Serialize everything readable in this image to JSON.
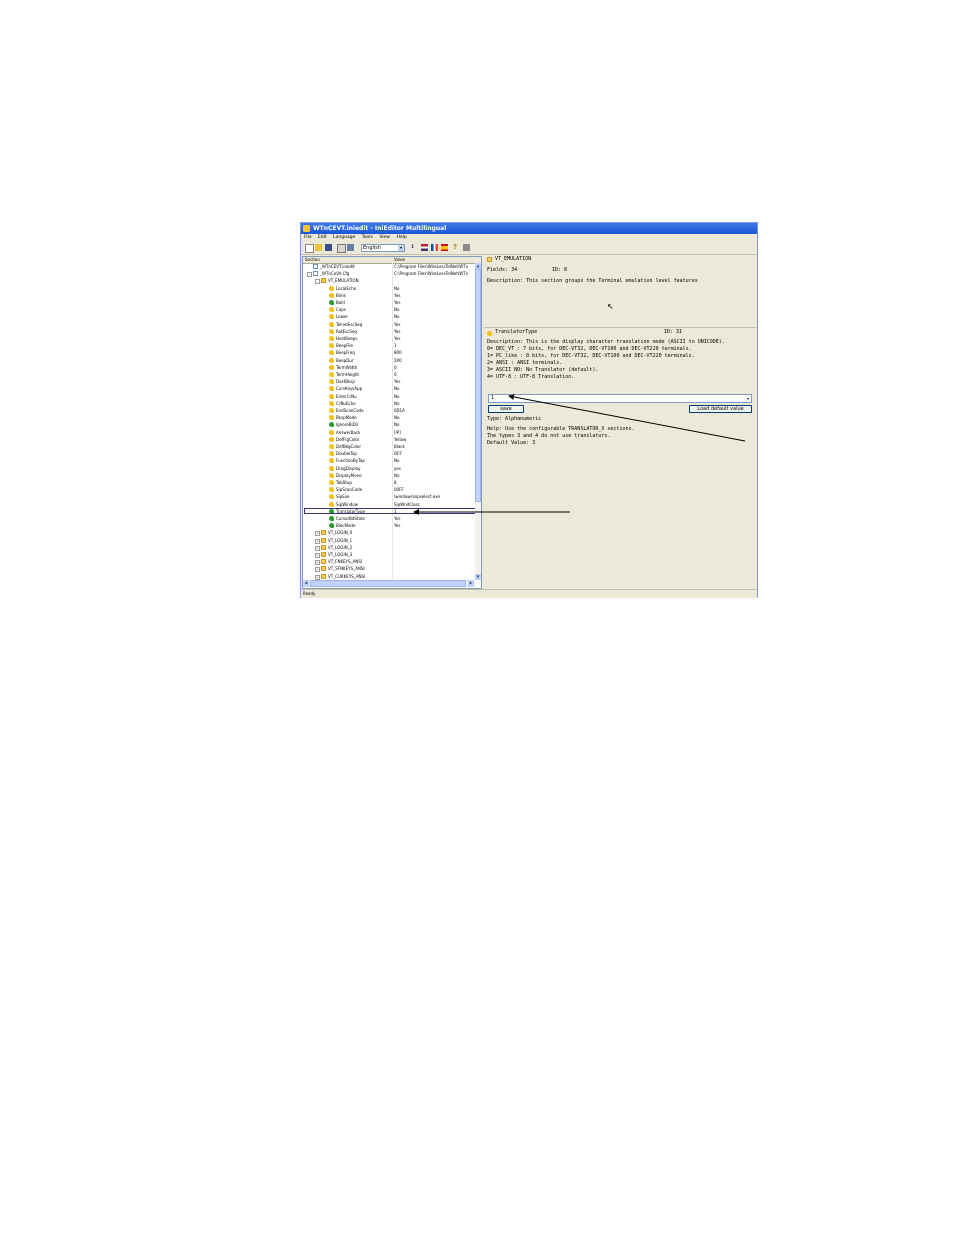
{
  "window": {
    "title": "WTnCEVT.iniedit - IniEditor Multilingual"
  },
  "menu": [
    "File",
    "Edit",
    "Language",
    "Tools",
    "View",
    "Help"
  ],
  "toolbar": {
    "language": "English"
  },
  "tree": {
    "headers": {
      "section": "Section",
      "value": "Value"
    },
    "rows": [
      {
        "name": "_WTnCEVT.iniedit",
        "value": "C:\\Program Files\\WireLessTelNet\\WTn",
        "icon": "file",
        "indent": 0,
        "pm": ""
      },
      {
        "name": "_WTnCeVA.Cfg",
        "value": "C:\\Program Files\\WireLessTelNet\\WTn",
        "icon": "file",
        "indent": 0,
        "pm": "-"
      },
      {
        "name": "VT_EMULATION",
        "value": "",
        "icon": "folder",
        "indent": 1,
        "pm": "-"
      },
      {
        "name": "LocalEcho",
        "value": "No",
        "icon": "key",
        "indent": 2
      },
      {
        "name": "Blink",
        "value": "Yes",
        "icon": "key",
        "indent": 2
      },
      {
        "name": "Bold",
        "value": "Yes",
        "icon": "keyg",
        "indent": 2
      },
      {
        "name": "Caps",
        "value": "No",
        "icon": "key",
        "indent": 2
      },
      {
        "name": "Lower",
        "value": "No",
        "icon": "key",
        "indent": 2
      },
      {
        "name": "TelnetEscSeq",
        "value": "Yes",
        "icon": "key",
        "indent": 2
      },
      {
        "name": "RotEscSeq",
        "value": "Yes",
        "icon": "key",
        "indent": 2
      },
      {
        "name": "HostBeeps",
        "value": "Yes",
        "icon": "key",
        "indent": 2
      },
      {
        "name": "BeepFile",
        "value": "1",
        "icon": "key",
        "indent": 2
      },
      {
        "name": "BeepFreq",
        "value": "800",
        "icon": "key",
        "indent": 2
      },
      {
        "name": "BeepDur",
        "value": "200",
        "icon": "key",
        "indent": 2
      },
      {
        "name": "TermWidth",
        "value": "0",
        "icon": "key",
        "indent": 2
      },
      {
        "name": "TermHeight",
        "value": "0",
        "icon": "key",
        "indent": 2
      },
      {
        "name": "DestBksp",
        "value": "Yes",
        "icon": "key",
        "indent": 2
      },
      {
        "name": "CursKeysApp",
        "value": "No",
        "icon": "key",
        "indent": 2
      },
      {
        "name": "EnterCrNu",
        "value": "No",
        "icon": "key",
        "indent": 2
      },
      {
        "name": "CrNuEcho",
        "value": "No",
        "icon": "key",
        "indent": 2
      },
      {
        "name": "EndScanCode",
        "value": "0D1A",
        "icon": "key",
        "indent": 2
      },
      {
        "name": "BkspMode",
        "value": "No",
        "icon": "key",
        "indent": 2
      },
      {
        "name": "IgnoreBiDir",
        "value": "No",
        "icon": "keyg",
        "indent": 2
      },
      {
        "name": "AnswerBack",
        "value": "[IP]",
        "icon": "key",
        "indent": 2
      },
      {
        "name": "DefFrgColor",
        "value": "Yellow",
        "icon": "key",
        "indent": 2
      },
      {
        "name": "DefBkgColor",
        "value": "Black",
        "icon": "key",
        "indent": 2
      },
      {
        "name": "DoubleTap",
        "value": "OFF",
        "icon": "key",
        "indent": 2
      },
      {
        "name": "FunctionByTap",
        "value": "No",
        "icon": "key",
        "indent": 2
      },
      {
        "name": "DragDisplay",
        "value": "yes",
        "icon": "key",
        "indent": 2
      },
      {
        "name": "DisplayMono",
        "value": "No",
        "icon": "key",
        "indent": 2
      },
      {
        "name": "TabStop",
        "value": "8",
        "icon": "key",
        "indent": 2
      },
      {
        "name": "SipScanCode",
        "value": "00FF",
        "icon": "key",
        "indent": 2
      },
      {
        "name": "SipExe",
        "value": "\\windows\\sipselect.exe",
        "icon": "key",
        "indent": 2
      },
      {
        "name": "SipWindow",
        "value": "SipWndClass",
        "icon": "key",
        "indent": 2
      },
      {
        "name": "TranslatorType",
        "value": "1",
        "icon": "keyg",
        "indent": 2,
        "selected": true
      },
      {
        "name": "CursorBdState",
        "value": "Yes",
        "icon": "keyg",
        "indent": 2
      },
      {
        "name": "BlocMode",
        "value": "Yes",
        "icon": "keyg",
        "indent": 2
      },
      {
        "name": "VT_LOGIN_0",
        "value": "",
        "icon": "folder",
        "indent": 1,
        "pm": "+"
      },
      {
        "name": "VT_LOGIN_1",
        "value": "",
        "icon": "folder",
        "indent": 1,
        "pm": "+"
      },
      {
        "name": "VT_LOGIN_2",
        "value": "",
        "icon": "folder",
        "indent": 1,
        "pm": "+"
      },
      {
        "name": "VT_LOGIN_3",
        "value": "",
        "icon": "folder",
        "indent": 1,
        "pm": "+"
      },
      {
        "name": "VT_FNKEYS_ANSI",
        "value": "",
        "icon": "folder",
        "indent": 1,
        "pm": "+"
      },
      {
        "name": "VT_SFNKEYS_ANSI",
        "value": "",
        "icon": "folder",
        "indent": 1,
        "pm": "+"
      },
      {
        "name": "VT_CURKEYS_ANSI",
        "value": "",
        "icon": "folder",
        "indent": 1,
        "pm": "+"
      }
    ]
  },
  "section_pane": {
    "title": "VT_EMULATION",
    "fields": "Fields: 34",
    "id": "ID: 8",
    "description": "Description: This section groups the Terminal emulation level features"
  },
  "field_pane": {
    "title": "TranslatorType",
    "id": "ID: 31",
    "description_lines": [
      "Description: This is the display character translation mode (ASCII to UNICODE).",
      "0= DEC_VT  : 7 bits, for DEC-VT32, DEC-VT100 and DEC-VT220 terminals.",
      "1= PC_like : 8 bits, for DEC-VT32, DEC-VT100 and DEC-VT220 terminals.",
      "2= ANSI    : ANSI terminals.",
      "3= ASCII NO: No Translator (default).",
      "4= UTF-8   : UTF-8 Translation."
    ],
    "value": "1",
    "save_label": "save",
    "load_default_label": "Load default value",
    "type": "Type: Alphanumeric",
    "help_lines": [
      "Help: Use the configurable TRANSLATOR_X sections.",
      "The types 3 and 4 do not use translators."
    ],
    "default_value": "Default Value: 3"
  },
  "status": {
    "text": "Ready"
  },
  "colors": {
    "titlebar": "#1c55d6",
    "window_bg": "#ece9d8",
    "selection_border": "#33367a"
  }
}
